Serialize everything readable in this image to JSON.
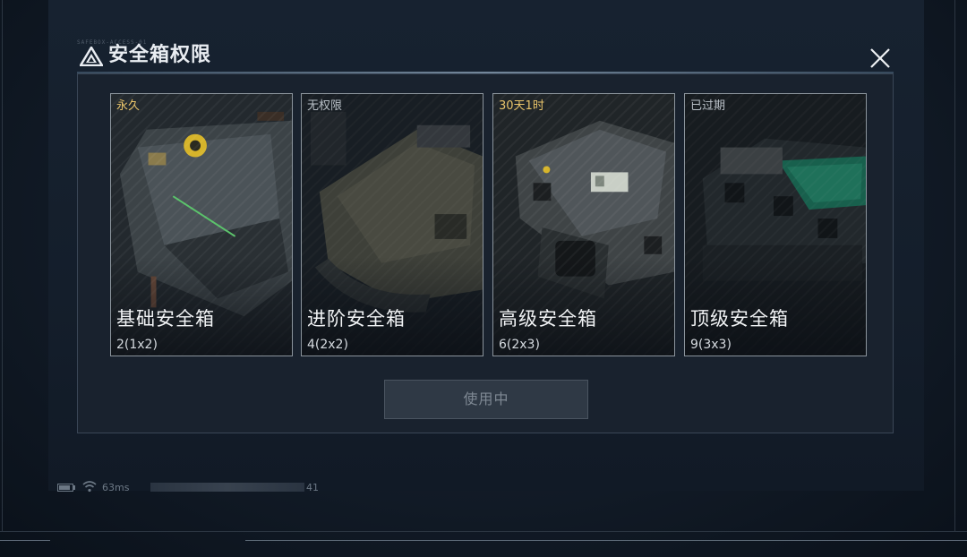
{
  "dialog": {
    "title": "安全箱权限",
    "title_tick": "SAFEBOX-ACCESS-01",
    "close_icon": "close-icon"
  },
  "cards": [
    {
      "status": "永久",
      "status_color": "#e9c46a",
      "name": "基础安全箱",
      "capacity": "2(1x2)",
      "body_color": "#3c4347"
    },
    {
      "status": "无权限",
      "status_color": "#b9c0c7",
      "name": "进阶安全箱",
      "capacity": "4(2x2)",
      "body_color": "#5a5a4c"
    },
    {
      "status": "30天1时",
      "status_color": "#e9c46a",
      "name": "高级安全箱",
      "capacity": "6(2x3)",
      "body_color": "#3f4446"
    },
    {
      "status": "已过期",
      "status_color": "#b9c0c7",
      "name": "顶级安全箱",
      "capacity": "9(3x3)",
      "body_color": "#2f3538"
    }
  ],
  "use_button": {
    "label": "使用中"
  },
  "statusbar": {
    "ping": "63ms",
    "uid_tail": "41",
    "battery_icon": "battery-icon",
    "wifi_icon": "wifi-icon"
  }
}
